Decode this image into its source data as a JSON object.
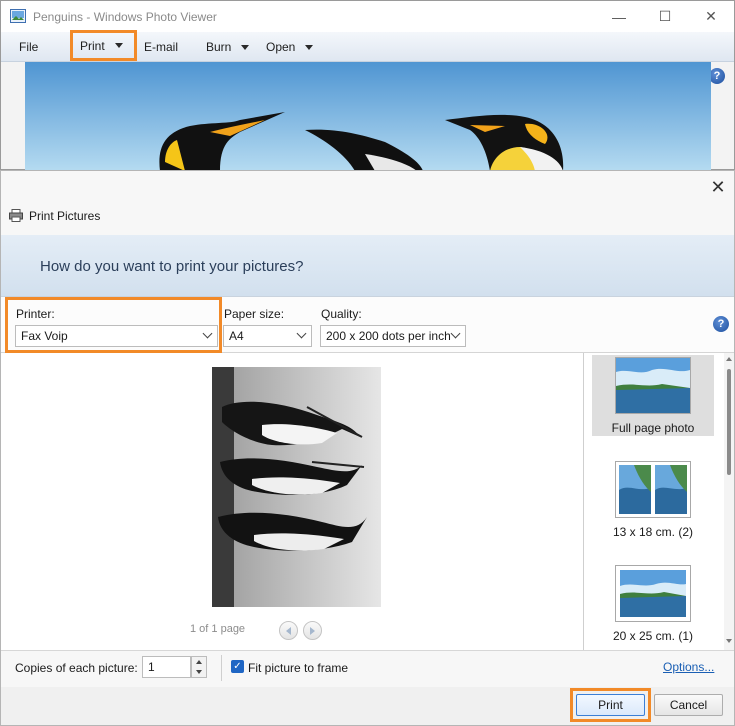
{
  "viewer": {
    "title": "Penguins - Windows Photo Viewer",
    "window_controls": {
      "minimize": "—",
      "maximize": "☐",
      "close": "✕"
    },
    "menu": {
      "file": "File",
      "print": "Print",
      "email": "E-mail",
      "burn": "Burn",
      "open": "Open"
    },
    "help": "?"
  },
  "dialog": {
    "title": "Print Pictures",
    "close": "✕",
    "question": "How do you want to print your pictures?",
    "printer": {
      "label": "Printer:",
      "value": "Fax Voip"
    },
    "paper_size": {
      "label": "Paper size:",
      "value": "A4"
    },
    "quality": {
      "label": "Quality:",
      "value": "200 x 200 dots per inch"
    },
    "help": "?",
    "preview": {
      "page_counter": "1 of 1 page"
    },
    "layouts": [
      {
        "label": "Full page photo",
        "selected": true
      },
      {
        "label": "13 x 18 cm. (2)",
        "selected": false
      },
      {
        "label": "20 x 25 cm. (1)",
        "selected": false
      }
    ],
    "copies": {
      "label": "Copies of each picture:",
      "value": "1"
    },
    "fit_to_frame": {
      "label": "Fit picture to frame",
      "checked": true,
      "check_glyph": "✓"
    },
    "options_link": "Options...",
    "buttons": {
      "print": "Print",
      "cancel": "Cancel"
    }
  },
  "colors": {
    "highlight": "#f28a28",
    "link": "#1a5fb4",
    "checkbox": "#1f66c4"
  }
}
